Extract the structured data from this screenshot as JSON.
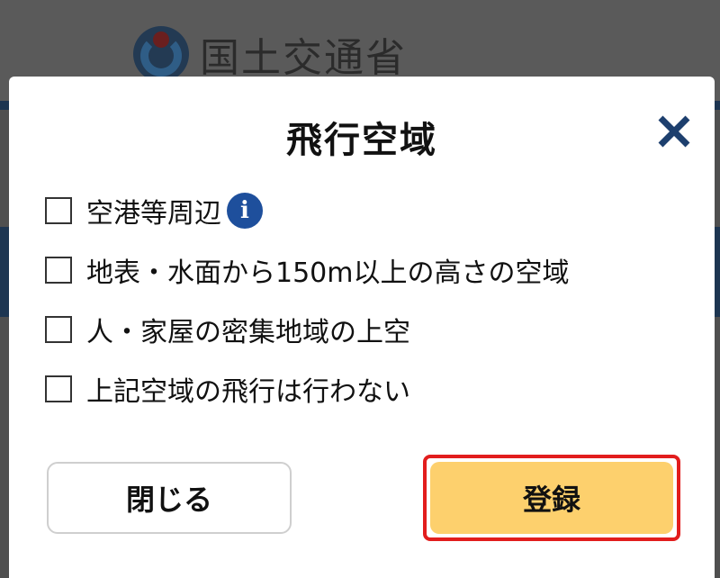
{
  "background": {
    "logo_text": "国土交通省"
  },
  "modal": {
    "title": "飛行空域",
    "close_icon": "close-icon",
    "options": [
      {
        "label": "空港等周辺",
        "checked": false,
        "has_info": true
      },
      {
        "label": "地表・水面から150m以上の高さの空域",
        "checked": false,
        "has_info": false
      },
      {
        "label": "人・家屋の密集地域の上空",
        "checked": false,
        "has_info": false
      },
      {
        "label": "上記空域の飛行は行わない",
        "checked": false,
        "has_info": false
      }
    ],
    "info_glyph": "i",
    "close_button_label": "閉じる",
    "register_button_label": "登録"
  },
  "colors": {
    "accent_blue": "#1e4f9c",
    "close_x": "#1d3f6e",
    "register_bg": "#fdd06d",
    "highlight_border": "#e21d1d"
  }
}
